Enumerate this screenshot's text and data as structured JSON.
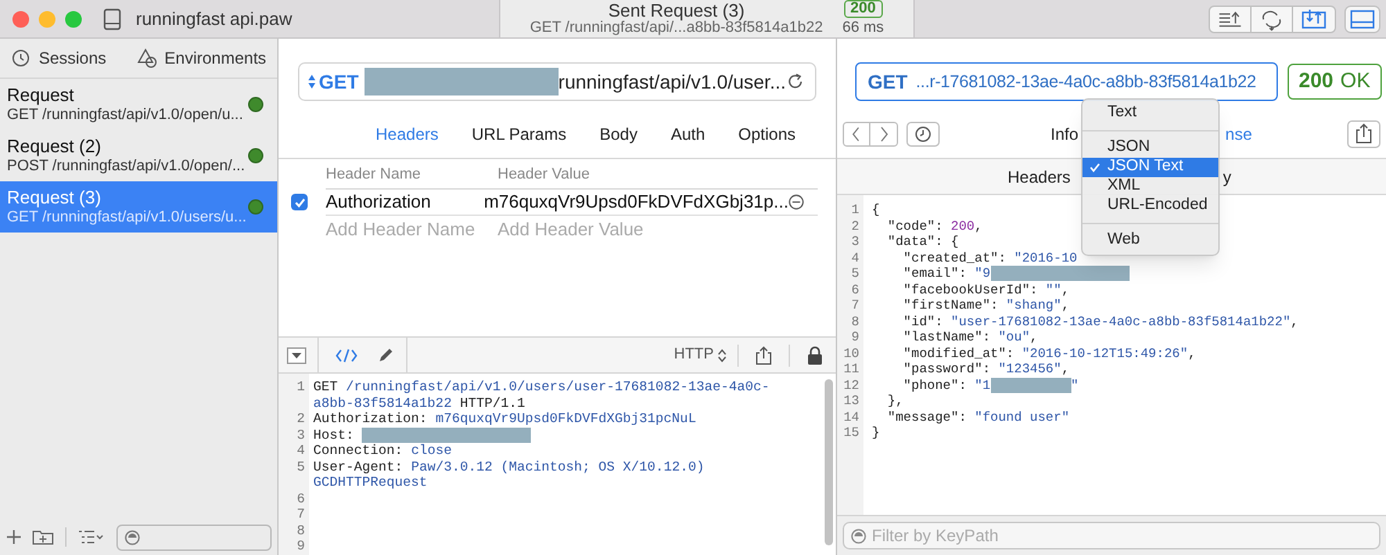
{
  "window": {
    "title": "runningfast api.paw"
  },
  "toolbar": {
    "title": "Sent Request (3)",
    "subtitle": "GET /runningfast/api/...a8bb-83f5814a1b22",
    "status": "200",
    "time": "66 ms"
  },
  "sidebar": {
    "tabs": [
      {
        "label": "Sessions",
        "kind": "clock"
      },
      {
        "label": "Environments",
        "kind": "shapes"
      }
    ],
    "requests": [
      {
        "name": "Request",
        "url": "GET /runningfast/api/v1.0/open/u...",
        "selected": false
      },
      {
        "name": "Request (2)",
        "url": "POST /runningfast/api/v1.0/open/...",
        "selected": false
      },
      {
        "name": "Request (3)",
        "url": "GET /runningfast/api/v1.0/users/u...",
        "selected": true
      }
    ]
  },
  "request": {
    "method": "GET",
    "url": "runningfast/api/v1.0/user...",
    "tabs": [
      {
        "label": "Headers",
        "selected": true
      },
      {
        "label": "URL Params",
        "selected": false
      },
      {
        "label": "Body",
        "selected": false
      },
      {
        "label": "Auth",
        "selected": false
      },
      {
        "label": "Options",
        "selected": false
      }
    ],
    "columns": [
      "Header Name",
      "Header Value"
    ],
    "headers": [
      {
        "name": "Authorization",
        "value": "m76quxqVr9Upsd0FkDVFdXGbj31p...",
        "checked": true
      }
    ],
    "new_header": {
      "name_placeholder": "Add Header Name",
      "value_placeholder": "Add Header Value"
    },
    "format": "HTTP",
    "lines": [
      {
        "number": "1",
        "rows": [
          [
            {
              "kind": "plain",
              "text": "GET "
            },
            {
              "kind": "value",
              "text": "/runningfast/api/v1.0/users/user-17681082-13ae-4a0c-"
            }
          ],
          [
            {
              "kind": "value",
              "text": "a8bb-83f5814a1b22"
            },
            {
              "kind": "plain",
              "text": " HTTP/1.1"
            }
          ]
        ]
      },
      {
        "number": "2",
        "rows": [
          [
            {
              "kind": "plain",
              "text": "Authorization: "
            },
            {
              "kind": "value",
              "text": "m76quxqVr9Upsd0FkDVFdXGbj31pcNuL"
            }
          ]
        ]
      },
      {
        "number": "3",
        "rows": [
          [
            {
              "kind": "plain",
              "text": "Host: "
            },
            {
              "kind": "redacted_host"
            }
          ]
        ]
      },
      {
        "number": "4",
        "rows": [
          [
            {
              "kind": "plain",
              "text": "Connection: "
            },
            {
              "kind": "value",
              "text": "close"
            }
          ]
        ]
      },
      {
        "number": "5",
        "rows": [
          [
            {
              "kind": "plain",
              "text": "User-Agent: "
            },
            {
              "kind": "value",
              "text": "Paw/3.0.12 (Macintosh; OS X/10.12.0)"
            }
          ],
          [
            {
              "kind": "value",
              "text": "GCDHTTPRequest"
            }
          ]
        ]
      },
      {
        "number": "6"
      },
      {
        "number": "7"
      },
      {
        "number": "8"
      },
      {
        "number": "9"
      }
    ]
  },
  "response": {
    "method": "GET",
    "url": "...r-17681082-13ae-4a0c-a8bb-83f5814a1b22",
    "status_code": "200",
    "status_text": "OK",
    "tabs": [
      {
        "label": "Info",
        "selected": false
      },
      {
        "label": "nse",
        "selected": true
      }
    ],
    "subtabs": [
      {
        "label": "Headers",
        "selected": false
      },
      {
        "label": "y",
        "selected": false
      }
    ],
    "lines": [
      {
        "number": "1",
        "segments": [
          {
            "kind": "plain",
            "text": "{"
          }
        ]
      },
      {
        "number": "2",
        "segments": [
          {
            "kind": "plain",
            "text": "  \"code\": "
          },
          {
            "kind": "number",
            "text": "200"
          },
          {
            "kind": "plain",
            "text": ","
          }
        ]
      },
      {
        "number": "3",
        "segments": [
          {
            "kind": "plain",
            "text": "  \"data\": {"
          }
        ]
      },
      {
        "number": "4",
        "segments": [
          {
            "kind": "plain",
            "text": "    \"created_at\": "
          },
          {
            "kind": "string",
            "text": "\"2016-10"
          }
        ]
      },
      {
        "number": "5",
        "segments": [
          {
            "kind": "plain",
            "text": "    \"email\": "
          },
          {
            "kind": "string",
            "text": "\"9"
          },
          {
            "kind": "redacted_long"
          }
        ]
      },
      {
        "number": "6",
        "segments": [
          {
            "kind": "plain",
            "text": "    \"facebookUserId\": "
          },
          {
            "kind": "string",
            "text": "\"\""
          },
          {
            "kind": "plain",
            "text": ","
          }
        ]
      },
      {
        "number": "7",
        "segments": [
          {
            "kind": "plain",
            "text": "    \"firstName\": "
          },
          {
            "kind": "string",
            "text": "\"shang\""
          },
          {
            "kind": "plain",
            "text": ","
          }
        ]
      },
      {
        "number": "8",
        "segments": [
          {
            "kind": "plain",
            "text": "    \"id\": "
          },
          {
            "kind": "string",
            "text": "\"user-17681082-13ae-4a0c-a8bb-83f5814a1b22\""
          },
          {
            "kind": "plain",
            "text": ","
          }
        ]
      },
      {
        "number": "9",
        "segments": [
          {
            "kind": "plain",
            "text": "    \"lastName\": "
          },
          {
            "kind": "string",
            "text": "\"ou\""
          },
          {
            "kind": "plain",
            "text": ","
          }
        ]
      },
      {
        "number": "10",
        "segments": [
          {
            "kind": "plain",
            "text": "    \"modified_at\": "
          },
          {
            "kind": "string",
            "text": "\"2016-10-12T15:49:26\""
          },
          {
            "kind": "plain",
            "text": ","
          }
        ]
      },
      {
        "number": "11",
        "segments": [
          {
            "kind": "plain",
            "text": "    \"password\": "
          },
          {
            "kind": "string",
            "text": "\"123456\""
          },
          {
            "kind": "plain",
            "text": ","
          }
        ]
      },
      {
        "number": "12",
        "segments": [
          {
            "kind": "plain",
            "text": "    \"phone\": "
          },
          {
            "kind": "string",
            "text": "\"1"
          },
          {
            "kind": "redacted_short"
          },
          {
            "kind": "string",
            "text": "\""
          }
        ]
      },
      {
        "number": "13",
        "segments": [
          {
            "kind": "plain",
            "text": "  },"
          }
        ]
      },
      {
        "number": "14",
        "segments": [
          {
            "kind": "plain",
            "text": "  \"message\": "
          },
          {
            "kind": "string",
            "text": "\"found user\""
          }
        ]
      },
      {
        "number": "15",
        "segments": [
          {
            "kind": "plain",
            "text": "}"
          }
        ]
      }
    ],
    "filter": {
      "placeholder": "Filter by KeyPath"
    }
  },
  "format_menu": [
    {
      "kind": "item",
      "label": "Text",
      "selected": false
    },
    {
      "kind": "separator"
    },
    {
      "kind": "item",
      "label": "JSON",
      "selected": false
    },
    {
      "kind": "item",
      "label": "JSON Text",
      "selected": true
    },
    {
      "kind": "item",
      "label": "XML",
      "selected": false
    },
    {
      "kind": "item",
      "label": "URL-Encoded",
      "selected": false
    },
    {
      "kind": "separator"
    },
    {
      "kind": "item",
      "label": "Web",
      "selected": false
    }
  ]
}
